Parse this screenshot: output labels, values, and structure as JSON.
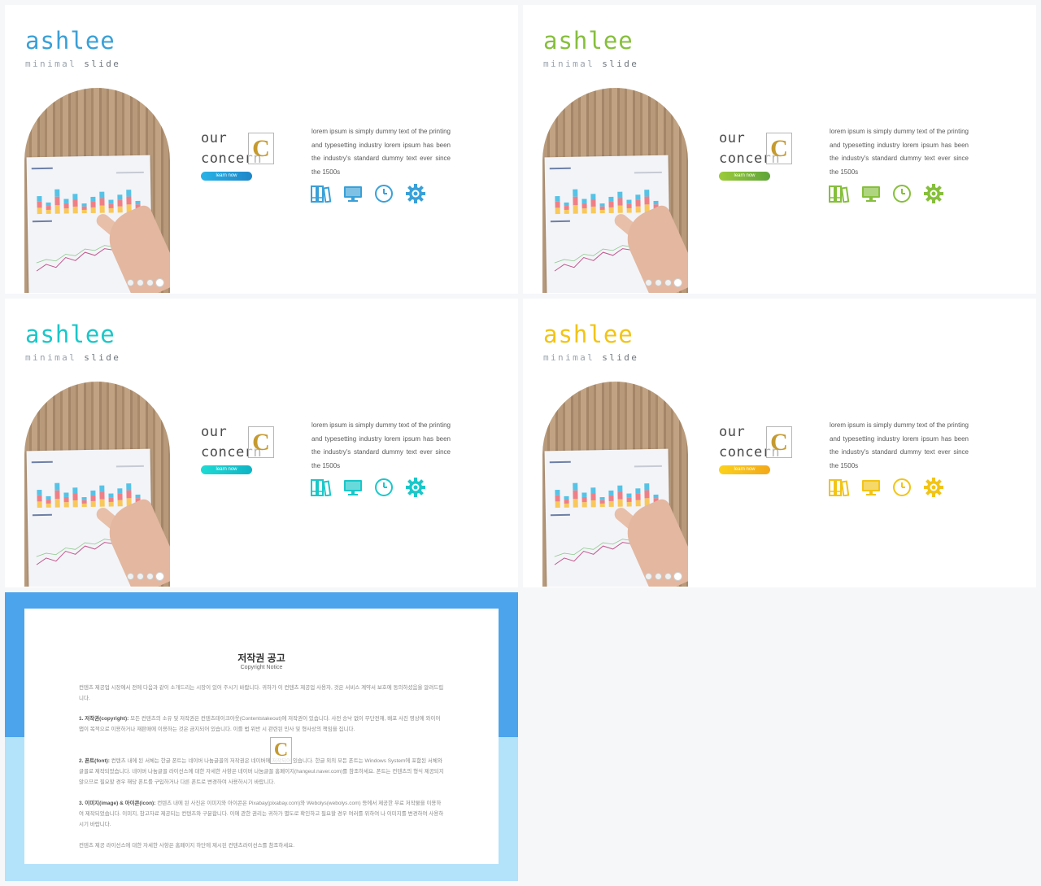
{
  "slides": [
    {
      "brand": "ashlee",
      "subtitle_w1": "minimal",
      "subtitle_w2": "slide",
      "heading_line1": "our",
      "heading_line2": "concern",
      "logo_letter": "C",
      "button": "learn now",
      "body": "lorem ipsum is simply dummy text of the printing and typesetting industry lorem ipsum has been the industry's standard dummy text ever since the 1500s",
      "accent": "#3aa0d8",
      "button_gradient": [
        "#29b3e6",
        "#1e86c8"
      ],
      "icons": [
        "books-icon",
        "monitor-icon",
        "clock-icon",
        "gear-icon"
      ]
    },
    {
      "brand": "ashlee",
      "subtitle_w1": "minimal",
      "subtitle_w2": "slide",
      "heading_line1": "our",
      "heading_line2": "concern",
      "logo_letter": "C",
      "button": "learn now",
      "body": "lorem ipsum is simply dummy text of the printing and typesetting industry lorem ipsum has been the industry's standard dummy text ever since the 1500s",
      "accent": "#86bf3c",
      "button_gradient": [
        "#9ccb3b",
        "#5fa43a"
      ],
      "icons": [
        "books-icon",
        "monitor-icon",
        "clock-icon",
        "gear-icon"
      ]
    },
    {
      "brand": "ashlee",
      "subtitle_w1": "minimal",
      "subtitle_w2": "slide",
      "heading_line1": "our",
      "heading_line2": "concern",
      "logo_letter": "C",
      "button": "learn now",
      "body": "lorem ipsum is simply dummy text of the printing and typesetting industry lorem ipsum has been the industry's standard dummy text ever since the 1500s",
      "accent": "#1ac7c9",
      "button_gradient": [
        "#1edbd4",
        "#0fb3c4"
      ],
      "icons": [
        "books-icon",
        "monitor-icon",
        "clock-icon",
        "gear-icon"
      ]
    },
    {
      "brand": "ashlee",
      "subtitle_w1": "minimal",
      "subtitle_w2": "slide",
      "heading_line1": "our",
      "heading_line2": "concern",
      "logo_letter": "C",
      "button": "learn now",
      "body": "lorem ipsum is simply dummy text of the printing and typesetting industry lorem ipsum has been the industry's standard dummy text ever since the 1500s",
      "accent": "#f2c417",
      "button_gradient": [
        "#fbd21b",
        "#f3a81a"
      ],
      "icons": [
        "books-icon",
        "monitor-icon",
        "clock-icon",
        "gear-icon"
      ]
    }
  ],
  "copyright": {
    "title": "저작권 공고",
    "subtitle": "Copyright Notice",
    "logo_letter": "C",
    "intro": "컨텐츠 제공업 시장에서 전에 다음과 같이 소개드리는 시장이 있어 주시기 바랍니다. 귀하가 이 컨텐츠 제공업 사용자, 것은 서비스 계약서 보호에 동의하셨음을 알려드립니다.",
    "p1_head": "1. 저작권(copyright):",
    "p1": "모든 컨텐츠의 소유 및 저작권은 컨텐츠테이크아웃(Contentstakeout)에 저작권이 있습니다. 사전 승낙 없이 무단전재, 배포 사진 영상에 와이어 앱이 목적으로 이용하거나 재판매에 이용하는 것은 금지되어 있습니다. 이를 법 위반 시 관련된 민사 및 형사상의 책임을 집니다.",
    "p2_head": "2. 폰트(font):",
    "p2": "컨텐츠 내에 된 서체는 한글 폰트는 네이버 나눔글꼴의 저작권은 네이버에 저작되어 있습니다. 한글 외의 모든 폰트는 Windows System에 포함된 서체와 글꼴로 제작되었습니다. 네이버 나눔글꼴 라이선스에 대한 자세한 사항은 네이버 나눔글꼴 홈페이지(hangeul.naver.com)를 참조하세요. 폰트는 컨텐츠의 형식 제공되지 않으므로 필요할 경우 해당 폰트를 구입하거나 다른 폰트로 변경하여 사용하시기 바랍니다.",
    "p3_head": "3. 이미지(image) & 아이콘(icon):",
    "p3": "컨텐츠 내에 된 사진은 이미지와 아이콘은 Pixabay(pixabay.com)와 Webolys(webolys.com) 등에서 제공한 무료 저작물을 이용하여 제작되었습니다. 이미지, 참고자료 제공되는 컨텐츠와 구분합니다. 이에 관한 권리는 귀하가 별도로 확인하고 필요할 경우 여러를 위하여 나 이미지를 변경하여 사용하시기 바랍니다.",
    "outro": "컨텐츠 제공 라이선스에 대한 자세한 사항은 홈페이지 하단에 제시된 컨텐츠라이선스를 참조하세요."
  }
}
